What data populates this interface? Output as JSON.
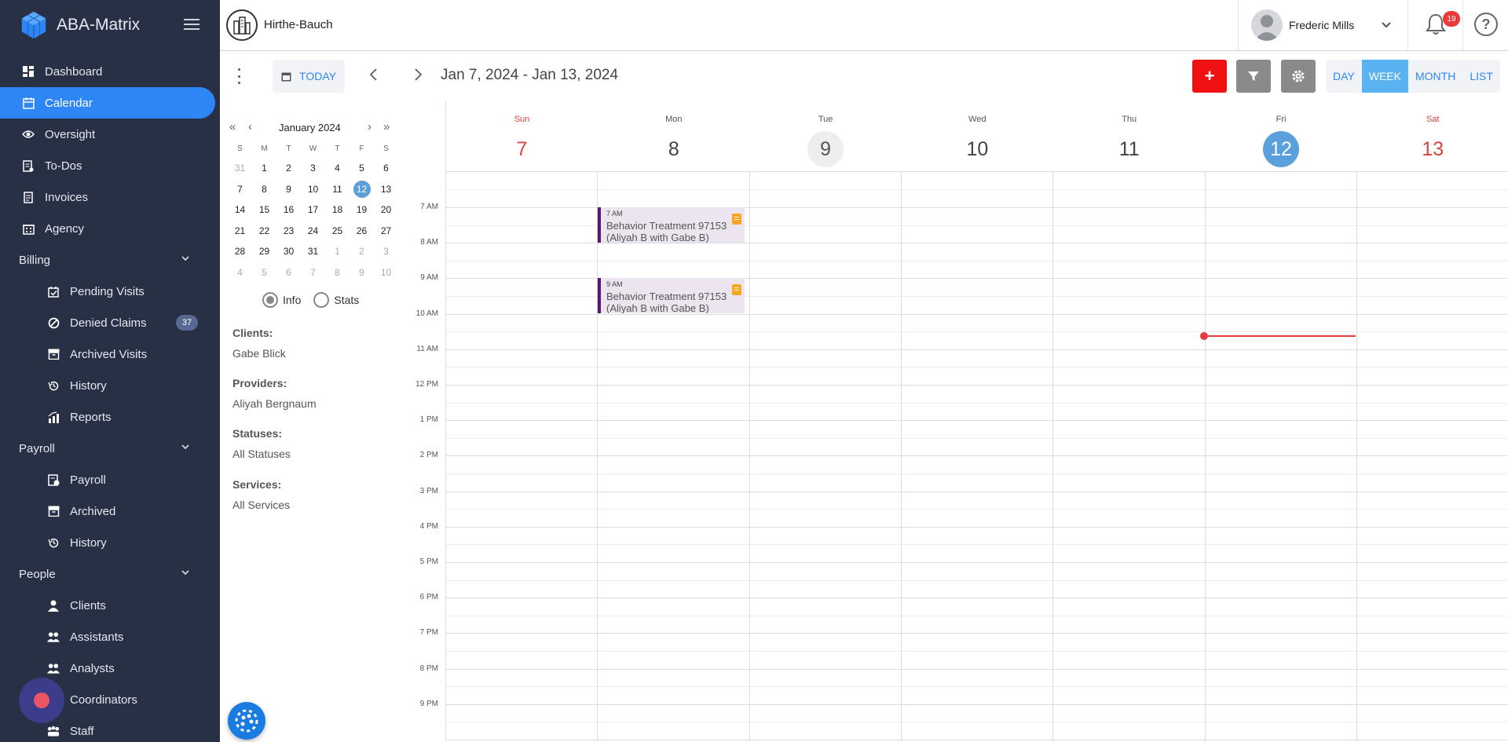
{
  "sidebar": {
    "brand": "ABA-Matrix",
    "items": {
      "dashboard": "Dashboard",
      "calendar": "Calendar",
      "oversight": "Oversight",
      "todos": "To-Dos",
      "invoices": "Invoices",
      "agency": "Agency"
    },
    "billing": {
      "label": "Billing",
      "pending_visits": "Pending Visits",
      "denied_claims": "Denied Claims",
      "denied_claims_count": "37",
      "archived_visits": "Archived Visits",
      "history": "History",
      "reports": "Reports"
    },
    "payroll": {
      "label": "Payroll",
      "payroll": "Payroll",
      "archived": "Archived",
      "history": "History"
    },
    "people": {
      "label": "People",
      "clients": "Clients",
      "assistants": "Assistants",
      "analysts": "Analysts",
      "coordinators": "Coordinators",
      "staff": "Staff"
    }
  },
  "header": {
    "company": "Hirthe-Bauch",
    "user_name": "Frederic Mills",
    "notification_count": "19",
    "help": "?"
  },
  "toolbar": {
    "today": "TODAY",
    "date_range": "Jan 7, 2024 - Jan 13, 2024",
    "add": "+",
    "views": {
      "day": "DAY",
      "week": "WEEK",
      "month": "MONTH",
      "list": "LIST"
    }
  },
  "mini_calendar": {
    "month": "January 2024",
    "dows": [
      "S",
      "M",
      "T",
      "W",
      "T",
      "F",
      "S"
    ],
    "weeks": [
      [
        "31",
        "1",
        "2",
        "3",
        "4",
        "5",
        "6"
      ],
      [
        "7",
        "8",
        "9",
        "10",
        "11",
        "12",
        "13"
      ],
      [
        "14",
        "15",
        "16",
        "17",
        "18",
        "19",
        "20"
      ],
      [
        "21",
        "22",
        "23",
        "24",
        "25",
        "26",
        "27"
      ],
      [
        "28",
        "29",
        "30",
        "31",
        "1",
        "2",
        "3"
      ],
      [
        "4",
        "5",
        "6",
        "7",
        "8",
        "9",
        "10"
      ]
    ]
  },
  "mode": {
    "info": "Info",
    "stats": "Stats",
    "selected": "info"
  },
  "filters": {
    "clients_label": "Clients:",
    "clients_value": "Gabe Blick",
    "providers_label": "Providers:",
    "providers_value": "Aliyah Bergnaum",
    "statuses_label": "Statuses:",
    "statuses_value": "All Statuses",
    "services_label": "Services:",
    "services_value": "All Services"
  },
  "week": {
    "days": [
      {
        "dow": "Sun",
        "num": "7"
      },
      {
        "dow": "Mon",
        "num": "8"
      },
      {
        "dow": "Tue",
        "num": "9"
      },
      {
        "dow": "Wed",
        "num": "10"
      },
      {
        "dow": "Thu",
        "num": "11"
      },
      {
        "dow": "Fri",
        "num": "12"
      },
      {
        "dow": "Sat",
        "num": "13"
      }
    ],
    "hours": [
      "7 AM",
      "8 AM",
      "9 AM",
      "10 AM",
      "11 AM",
      "12 PM",
      "1 PM",
      "2 PM",
      "3 PM",
      "4 PM",
      "5 PM",
      "6 PM",
      "7 PM",
      "8 PM",
      "9 PM"
    ]
  },
  "events": [
    {
      "time": "7 AM",
      "title": "Behavior Treatment 97153",
      "subtitle": "(Aliyah B with Gabe B)"
    },
    {
      "time": "9 AM",
      "title": "Behavior Treatment 97153",
      "subtitle": "(Aliyah B with Gabe B)"
    }
  ],
  "colors": {
    "sidebar_bg": "#283046",
    "accent": "#2e86f5",
    "danger": "#f01212",
    "event_border": "#5d1470",
    "event_bg": "#ece4ef"
  }
}
